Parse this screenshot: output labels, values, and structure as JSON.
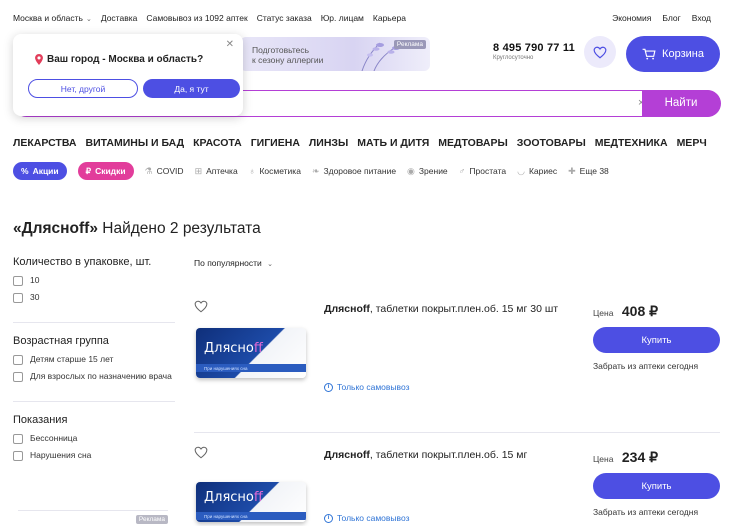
{
  "topbar": {
    "city": "Москва и область",
    "links": [
      "Доставка",
      "Самовывоз из 1092 аптек",
      "Статус заказа",
      "Юр. лицам",
      "Карьера"
    ],
    "right_links": [
      "Экономия",
      "Блог",
      "Вход"
    ]
  },
  "header": {
    "ad_line1": "Подготовьтесь",
    "ad_line2": "к сезону аллергии",
    "ad_badge": "Реклама",
    "phone": "8 495 790 77 11",
    "phone_note": "Круглосуточно",
    "cart_label": "Корзина"
  },
  "city_popup": {
    "question": "Ваш город - Москва и область?",
    "no_label": "Нет, другой",
    "yes_label": "Да, я тут"
  },
  "search": {
    "button_label": "Найти"
  },
  "categories": [
    "ЛЕКАРСТВА",
    "ВИТАМИНЫ И БАД",
    "КРАСОТА",
    "ГИГИЕНА",
    "ЛИНЗЫ",
    "МАТЬ И ДИТЯ",
    "МЕДТОВАРЫ",
    "ЗООТОВАРЫ",
    "МЕДТЕХНИКА",
    "МЕРЧ"
  ],
  "chips": {
    "promo": "Акции",
    "discount": "Скидки",
    "items": [
      "COVID",
      "Аптечка",
      "Косметика",
      "Здоровое питание",
      "Зрение",
      "Простата",
      "Кариес",
      "Еще 38"
    ]
  },
  "colors": {
    "accent": "#4d4fe3",
    "pink": "#e23d9b",
    "search_border": "#b43fd6"
  },
  "results": {
    "query": "«Дляснoff»",
    "count_text": "Найдено 2 результата"
  },
  "filters": [
    {
      "title": "Количество в упаковке, шт.",
      "options": [
        "10",
        "30"
      ]
    },
    {
      "title": "Возрастная группа",
      "options": [
        "Детям старше 15 лет",
        "Для взрослых по назначению врача"
      ]
    },
    {
      "title": "Показания",
      "options": [
        "Бессонница",
        "Нарушения сна"
      ]
    }
  ],
  "left_ad_badge": "Реклама",
  "sort": {
    "label": "По популярности"
  },
  "products": [
    {
      "brand": "Дляснoff",
      "desc": ", таблетки покрыт.плен.об. 15 мг 30 шт",
      "pack_brand_a": "Дляснo",
      "pack_brand_b": "ff",
      "pack_text": "При нарушениях сна",
      "pickup": "Только самовывоз",
      "price_label": "Цена",
      "price": "408 ₽",
      "buy_label": "Купить",
      "take_note": "Забрать из аптеки сегодня"
    },
    {
      "brand": "Дляснoff",
      "desc": ", таблетки покрыт.плен.об. 15 мг",
      "pack_brand_a": "Дляснo",
      "pack_brand_b": "ff",
      "pack_text": "При нарушениях сна",
      "pickup": "Только самовывоз",
      "price_label": "Цена",
      "price": "234 ₽",
      "buy_label": "Купить",
      "take_note": "Забрать из аптеки сегодня"
    }
  ]
}
